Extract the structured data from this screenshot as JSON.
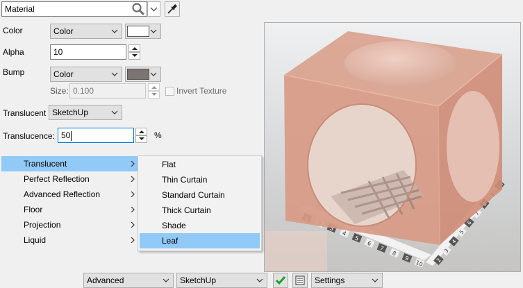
{
  "material_selector": {
    "value": "Material"
  },
  "properties": {
    "color": {
      "label": "Color",
      "mode": "Color",
      "swatch": "#ffffff"
    },
    "alpha": {
      "label": "Alpha",
      "value": "10"
    },
    "bump": {
      "label": "Bump",
      "mode": "Color",
      "swatch": "#7a7572"
    },
    "size": {
      "label": "Size:",
      "value": "0.100"
    },
    "invert_texture": {
      "label": "Invert Texture",
      "checked": false
    },
    "translucent": {
      "label": "Translucent",
      "value": "SketchUp"
    },
    "translucence": {
      "label": "Translucence:",
      "value": "50",
      "unit": "%"
    }
  },
  "context_menu": {
    "items": [
      {
        "label": "Translucent",
        "selected": true
      },
      {
        "label": "Perfect Reflection",
        "selected": false
      },
      {
        "label": "Advanced Reflection",
        "selected": false
      },
      {
        "label": "Floor",
        "selected": false
      },
      {
        "label": "Projection",
        "selected": false
      },
      {
        "label": "Liquid",
        "selected": false
      }
    ]
  },
  "submenu": {
    "items": [
      {
        "label": "Flat",
        "selected": false
      },
      {
        "label": "Thin Curtain",
        "selected": false
      },
      {
        "label": "Standard Curtain",
        "selected": false
      },
      {
        "label": "Thick Curtain",
        "selected": false
      },
      {
        "label": "Shade",
        "selected": false
      },
      {
        "label": "Leaf",
        "selected": true
      }
    ]
  },
  "bottom_bar": {
    "mode": "Advanced",
    "renderer": "SketchUp",
    "settings": "Settings"
  },
  "preview": {
    "cube_color": "#d89a85",
    "background": "#d6d8d8",
    "scale_numbers": [
      "1",
      "2",
      "3",
      "4",
      "5",
      "6",
      "7",
      "8",
      "9",
      "10",
      "2",
      "3",
      "4",
      "5",
      "6",
      "7",
      "8",
      "9",
      "10"
    ]
  }
}
